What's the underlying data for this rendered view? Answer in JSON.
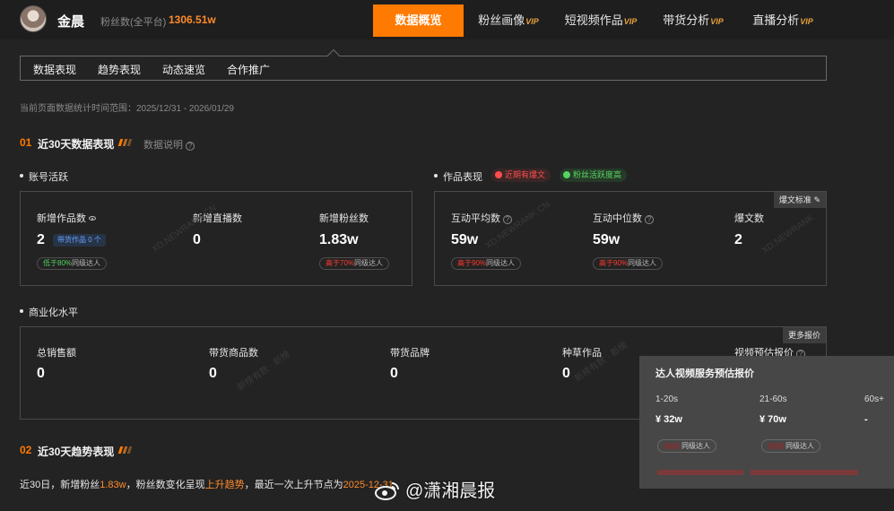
{
  "header": {
    "username": "金晨",
    "fans_label": "粉丝数(全平台)",
    "fans_value": "1306.51w",
    "nav": [
      {
        "label": "数据概览",
        "vip": "",
        "active": true
      },
      {
        "label": "粉丝画像",
        "vip": "VIP",
        "active": false
      },
      {
        "label": "短视频作品",
        "vip": "VIP",
        "active": false
      },
      {
        "label": "带货分析",
        "vip": "VIP",
        "active": false
      },
      {
        "label": "直播分析",
        "vip": "VIP",
        "active": false
      }
    ]
  },
  "subtabs": [
    "数据表现",
    "趋势表现",
    "动态速览",
    "合作推广"
  ],
  "range_text": "当前页面数据统计时间范围：2025/12/31 - 2026/01/29",
  "section1": {
    "num": "01",
    "title": "近30天数据表现",
    "help": "数据说明"
  },
  "account": {
    "title": "账号活跃",
    "metrics": [
      {
        "label": "新增作品数",
        "value": "2",
        "tag": "带货作品 0 个",
        "pill_hl": "低于80%",
        "pill_rest": "同级达人"
      },
      {
        "label": "新增直播数",
        "value": "0"
      },
      {
        "label": "新增粉丝数",
        "value": "1.83w",
        "pill_hl": "高于70%",
        "pill_rest": "同级达人"
      }
    ]
  },
  "works": {
    "title": "作品表现",
    "badge_red": "近期有爆文",
    "badge_green": "粉丝活跃度高",
    "corner_button": "爆文标准",
    "metrics": [
      {
        "label": "互动平均数",
        "value": "59w",
        "pill_hl": "高于90%",
        "pill_rest": "同级达人"
      },
      {
        "label": "互动中位数",
        "value": "59w",
        "pill_hl": "高于90%",
        "pill_rest": "同级达人"
      },
      {
        "label": "爆文数",
        "value": "2"
      }
    ]
  },
  "commerce": {
    "title": "商业化水平",
    "corner_button": "更多报价",
    "metrics": [
      {
        "label": "总销售额",
        "value": "0"
      },
      {
        "label": "带货商品数",
        "value": "0"
      },
      {
        "label": "带货品牌",
        "value": "0"
      },
      {
        "label": "种草作品",
        "value": "0"
      },
      {
        "label": "视频预估报价",
        "value": ""
      }
    ]
  },
  "popup": {
    "title": "达人视频服务预估报价",
    "columns": [
      {
        "head": "1-20s",
        "value": "¥ 32w",
        "pill": "同级达人"
      },
      {
        "head": "21-60s",
        "value": "¥ 70w",
        "pill": "同级达人"
      },
      {
        "head": "60s+",
        "value": "-"
      }
    ]
  },
  "section2": {
    "num": "02",
    "title": "近30天趋势表现"
  },
  "trend": {
    "p1": "近30日，新增粉丝",
    "fans": "1.83w",
    "p2": "，粉丝数变化呈现",
    "trend": "上升趋势",
    "p3": "，最近一次上升节点为",
    "date": "2025-12-31"
  },
  "watermarks": [
    "XD.NEWRANK.CN",
    "XD.NEWRANK.CN",
    "XD.NEWRANK",
    "新榜有数 · 新榜",
    "新榜有数 · 新榜"
  ],
  "weibo_handle": "@潇湘晨报"
}
